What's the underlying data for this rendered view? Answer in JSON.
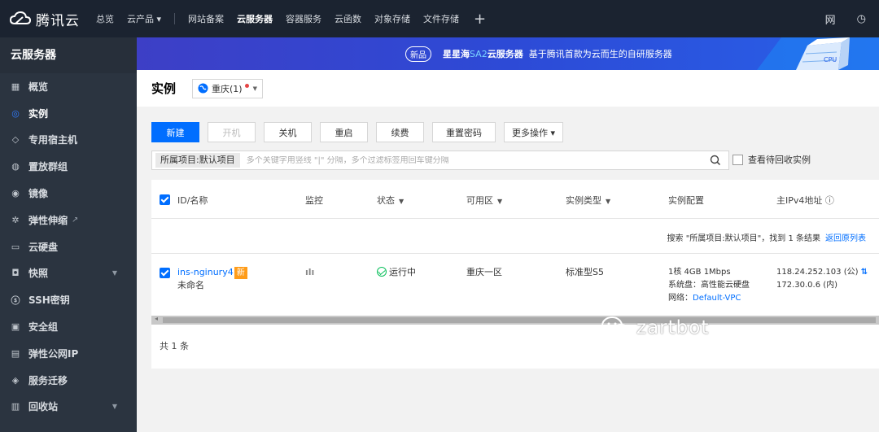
{
  "topbar": {
    "brand": "腾讯云",
    "nav": [
      {
        "label": "总览",
        "active": false
      },
      {
        "label": "云产品 ▾",
        "active": false
      },
      {
        "label": "网站备案",
        "active": false
      },
      {
        "label": "云服务器",
        "active": true
      },
      {
        "label": "容器服务",
        "active": false
      },
      {
        "label": "云函数",
        "active": false
      },
      {
        "label": "对象存储",
        "active": false
      },
      {
        "label": "文件存储",
        "active": false
      }
    ],
    "plus": "+",
    "right_icon_1": "网",
    "right_icon_2": "◷"
  },
  "sidebar": {
    "title": "云服务器",
    "items": [
      {
        "label": "概览",
        "icon": "▦"
      },
      {
        "label": "实例",
        "icon": "◎"
      },
      {
        "label": "专用宿主机",
        "icon": "◇"
      },
      {
        "label": "置放群组",
        "icon": "◍"
      },
      {
        "label": "镜像",
        "icon": "◉"
      },
      {
        "label": "弹性伸缩",
        "icon": "✲",
        "ext": "↗"
      },
      {
        "label": "云硬盘",
        "icon": "▭"
      },
      {
        "label": "快照",
        "icon": "◘",
        "arrow": "▼"
      },
      {
        "label": "SSH密钥",
        "icon": "ⓢ"
      },
      {
        "label": "安全组",
        "icon": "▣"
      },
      {
        "label": "弹性公网IP",
        "icon": "▤"
      },
      {
        "label": "服务迁移",
        "icon": "◈"
      },
      {
        "label": "回收站",
        "icon": "▥",
        "arrow": "▼"
      }
    ]
  },
  "banner": {
    "badge": "新品",
    "text_prefix": "星星海",
    "text_highlight": "SA2",
    "text_product": "云服务器",
    "text_desc": "基于腾讯首款为云而生的自研服务器",
    "art_label": "CPU"
  },
  "header": {
    "title": "实例",
    "region": "重庆(1)",
    "region_caret": "▼"
  },
  "toolbar": {
    "buttons": [
      {
        "label": "新建",
        "type": "primary"
      },
      {
        "label": "开机",
        "type": "disabled"
      },
      {
        "label": "关机",
        "type": "default"
      },
      {
        "label": "重启",
        "type": "default"
      },
      {
        "label": "续费",
        "type": "default"
      },
      {
        "label": "重置密码",
        "type": "default"
      },
      {
        "label": "更多操作 ▾",
        "type": "default"
      }
    ]
  },
  "search": {
    "tag": "所属项目:默认项目",
    "placeholder": "多个关键字用竖线 \"|\" 分隔，多个过滤标签用回车键分隔",
    "recycle_label": "查看待回收实例"
  },
  "table": {
    "headers": [
      {
        "label": "ID/名称",
        "filter": false
      },
      {
        "label": "监控",
        "filter": false
      },
      {
        "label": "状态",
        "filter": true
      },
      {
        "label": "可用区",
        "filter": true
      },
      {
        "label": "实例类型",
        "filter": true
      },
      {
        "label": "实例配置",
        "filter": false
      },
      {
        "label": "主IPv4地址 ⓘ",
        "filter": false
      }
    ],
    "filter_glyph": "▼",
    "result_text": "搜索 \"所属项目:默认项目\"，找到 1 条结果",
    "result_link": "返回原列表",
    "row": {
      "id": "ins-nginury4",
      "new_tag": "新",
      "name": "未命名",
      "monitor_icon": "ılı",
      "status": "运行中",
      "zone": "重庆一区",
      "type": "标准型S5",
      "config_line1": "1核 4GB 1Mbps",
      "config_line2": "系统盘：高性能云硬盘",
      "network_label": "网络：",
      "network_value": "Default-VPC",
      "ip_public": "118.24.252.103 (公)",
      "ip_private": "172.30.0.6 (内)",
      "copy_icon": "⇅"
    },
    "scroll_arrow": "◂",
    "total": "共 1 条"
  },
  "watermark": {
    "text": "zartbot"
  },
  "colors": {
    "primary": "#006eff",
    "topbar": "#1b2330",
    "sidebar": "#2b3440",
    "new_tag": "#ff9c19",
    "status_ok": "#0abf5b"
  }
}
